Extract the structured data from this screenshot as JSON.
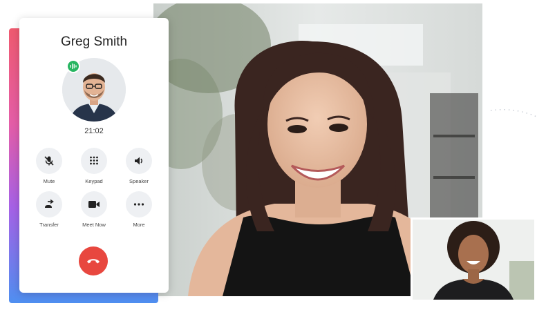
{
  "call": {
    "caller_name": "Greg Smith",
    "duration": "21:02",
    "status_badge_icon": "audio-wave-icon"
  },
  "controls": [
    {
      "label": "Mute",
      "icon": "muted-microphone-icon"
    },
    {
      "label": "Keypad",
      "icon": "keypad-icon"
    },
    {
      "label": "Speaker",
      "icon": "speaker-icon"
    },
    {
      "label": "Transfer",
      "icon": "transfer-icon"
    },
    {
      "label": "Meet Now",
      "icon": "video-camera-icon"
    },
    {
      "label": "More",
      "icon": "more-dots-icon"
    }
  ],
  "end_call": {
    "icon": "phone-hangup-icon"
  },
  "colors": {
    "end_call": "#e8473f",
    "audio_badge": "#27b561",
    "control_bg": "#eef0f3",
    "gradient": [
      "#ef5a6f",
      "#e45da8",
      "#a661e6",
      "#4f8ff0"
    ]
  }
}
